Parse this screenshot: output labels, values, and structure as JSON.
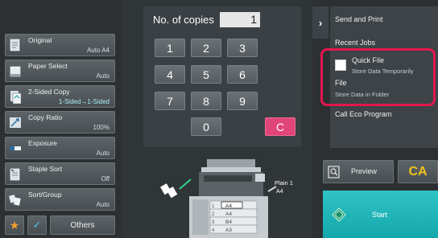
{
  "left_panel": {
    "functions": [
      {
        "label": "Original",
        "value": "Auto A4",
        "icon": "original-icon"
      },
      {
        "label": "Paper Select",
        "value": "Auto",
        "icon": "paper-icon"
      },
      {
        "label": "2-Sided Copy",
        "value": "1-Sided→1-Sided",
        "icon": "duplex-icon"
      },
      {
        "label": "Copy Ratio",
        "value": "100%",
        "icon": "ratio-icon"
      },
      {
        "label": "Exposure",
        "value": "Auto",
        "icon": "exposure-icon"
      },
      {
        "label": "Staple Sort",
        "value": "Off",
        "icon": "staple-icon"
      },
      {
        "label": "Sort/Group",
        "value": "Auto",
        "icon": "sort-icon"
      }
    ],
    "others_label": "Others"
  },
  "keypad": {
    "copies_label": "No. of copies",
    "copies_value": "1",
    "keys": [
      "1",
      "2",
      "3",
      "4",
      "5",
      "6",
      "7",
      "8",
      "9",
      "0"
    ],
    "clear_label": "C"
  },
  "machine": {
    "tray_label": "Plain 1",
    "tray_size": "A4",
    "cassettes": [
      {
        "num": "1",
        "size": "A4"
      },
      {
        "num": "2",
        "size": "A4"
      },
      {
        "num": "3",
        "size": "B4"
      },
      {
        "num": "4",
        "size": "A3"
      }
    ]
  },
  "right_panel": {
    "send_and_print": "Send and Print",
    "recent_jobs": "Recent Jobs",
    "quick_file": "Quick File",
    "quick_file_sub": "Store Data Temporarily",
    "file": "File",
    "file_sub": "Store Data in Folder",
    "call_eco": "Call Eco Program",
    "preview_label": "Preview",
    "ca_label": "CA",
    "start_label": "Start"
  },
  "colors": {
    "accent_pink": "#e0457a",
    "highlight_red": "#e3174e",
    "start_teal": "#1fb3b6",
    "ca_yellow": "#f3c01b"
  }
}
